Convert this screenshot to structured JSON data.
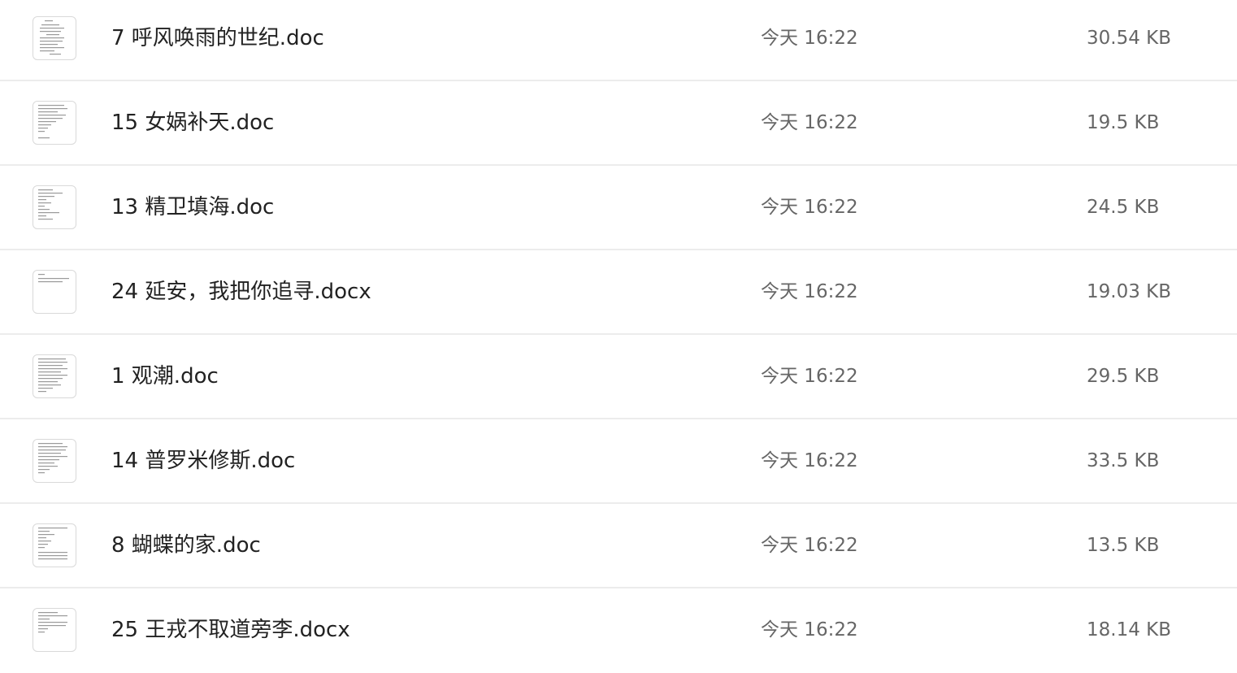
{
  "files": [
    {
      "name": "7 呼风唤雨的世纪.doc",
      "date": "今天 16:22",
      "size": "30.54 KB",
      "icon": "document-thumbnail-icon"
    },
    {
      "name": "15 女娲补天.doc",
      "date": "今天 16:22",
      "size": "19.5 KB",
      "icon": "document-thumbnail-icon"
    },
    {
      "name": "13 精卫填海.doc",
      "date": "今天 16:22",
      "size": "24.5 KB",
      "icon": "document-thumbnail-icon"
    },
    {
      "name": "24 延安，我把你追寻.docx",
      "date": "今天 16:22",
      "size": "19.03 KB",
      "icon": "document-thumbnail-icon"
    },
    {
      "name": "1 观潮.doc",
      "date": "今天 16:22",
      "size": "29.5 KB",
      "icon": "document-thumbnail-icon"
    },
    {
      "name": "14 普罗米修斯.doc",
      "date": "今天 16:22",
      "size": "33.5 KB",
      "icon": "document-thumbnail-icon"
    },
    {
      "name": "8 蝴蝶的家.doc",
      "date": "今天 16:22",
      "size": "13.5 KB",
      "icon": "document-thumbnail-icon"
    },
    {
      "name": "25 王戎不取道旁李.docx",
      "date": "今天 16:22",
      "size": "18.14 KB",
      "icon": "document-thumbnail-icon"
    }
  ]
}
